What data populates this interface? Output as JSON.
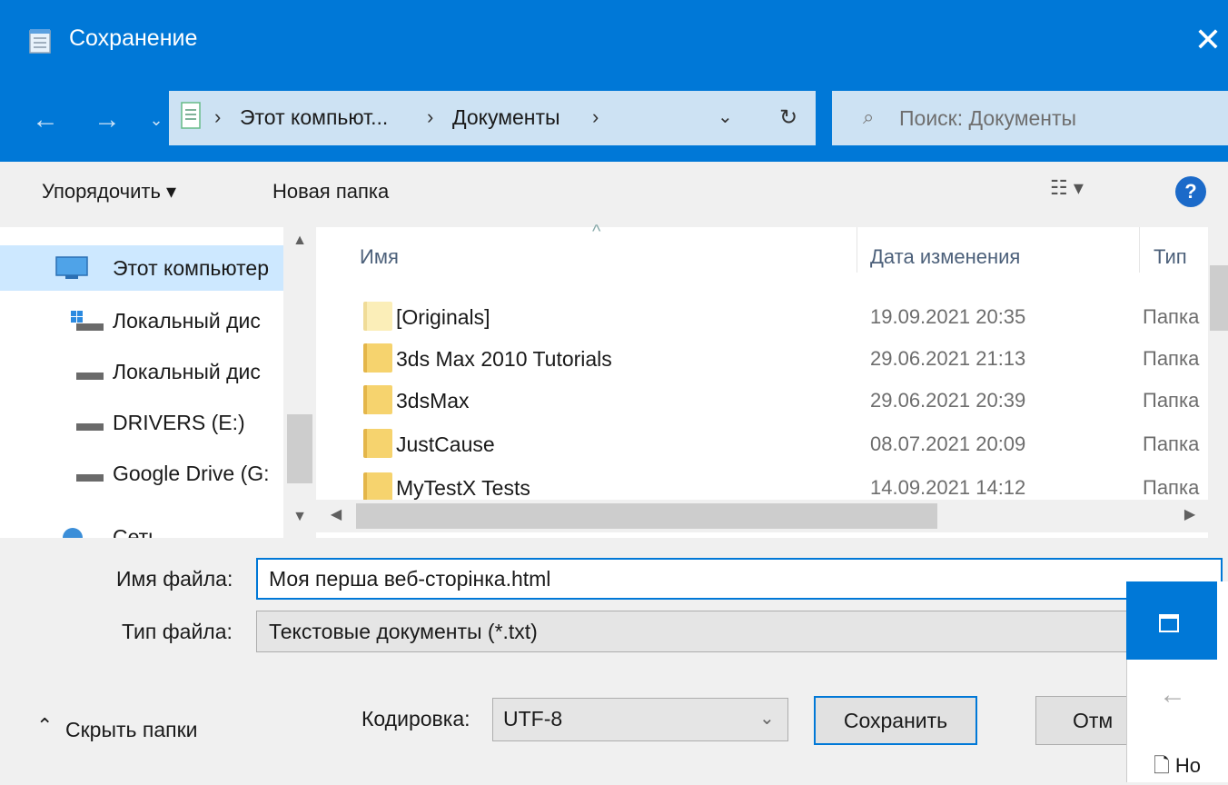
{
  "window": {
    "title": "Сохранение",
    "close_label": "✕"
  },
  "address": {
    "crumbs": [
      "Этот компьют...",
      "Документы"
    ],
    "search_placeholder": "Поиск: Документы"
  },
  "toolbar": {
    "organize_label": "Упорядочить ▾",
    "new_folder_label": "Новая папка",
    "help_label": "?"
  },
  "nav_pane": {
    "items": [
      {
        "label": "Этот компьютер",
        "icon": "computer-icon"
      },
      {
        "label": "Локальный дис",
        "icon": "windows-drive-icon"
      },
      {
        "label": "Локальный дис",
        "icon": "drive-icon"
      },
      {
        "label": "DRIVERS (E:)",
        "icon": "drive-icon"
      },
      {
        "label": "Google Drive (G:",
        "icon": "drive-icon"
      },
      {
        "label": "Сеть",
        "icon": "network-icon"
      }
    ]
  },
  "file_list": {
    "columns": [
      "Имя",
      "Дата изменения",
      "Тип"
    ],
    "rows": [
      {
        "name": "[Originals]",
        "date": "19.09.2021 20:35",
        "type": "Папка"
      },
      {
        "name": "3ds Max 2010 Tutorials",
        "date": "29.06.2021 21:13",
        "type": "Папка"
      },
      {
        "name": "3dsMax",
        "date": "29.06.2021 20:39",
        "type": "Папка"
      },
      {
        "name": "JustCause",
        "date": "08.07.2021 20:09",
        "type": "Папка"
      },
      {
        "name": "MyTestX Tests",
        "date": "14.09.2021 14:12",
        "type": "Папка"
      }
    ]
  },
  "form": {
    "filename_label": "Имя файла:",
    "filename_value": "Моя перша веб-сторінка.html",
    "filetype_label": "Тип файла:",
    "filetype_value": "Текстовые документы (*.txt)",
    "hide_folders_label": "Скрыть папки",
    "encoding_label": "Кодировка:",
    "encoding_value": "UTF-8",
    "save_label": "Сохранить",
    "cancel_label": "Отм"
  },
  "overlay_window": {
    "new_label": "Но"
  },
  "colors": {
    "accent": "#0078d7",
    "address_bg": "#cde2f3",
    "selection": "#cde8ff"
  }
}
